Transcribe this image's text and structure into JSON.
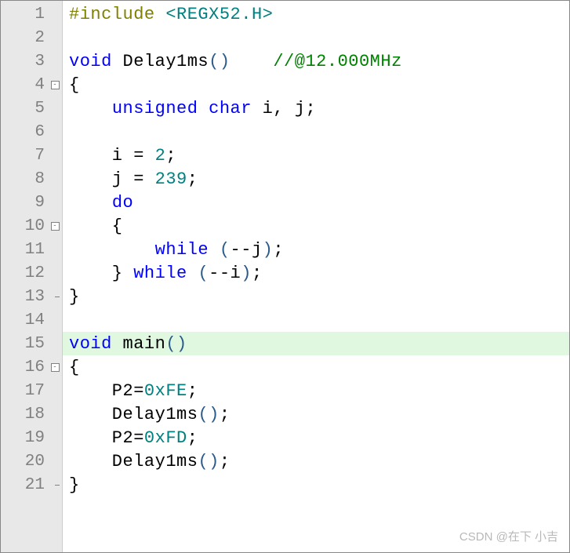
{
  "lines": [
    {
      "n": "1",
      "fold": "none",
      "hl": false,
      "tokens": [
        {
          "c": "preproc",
          "t": "#include "
        },
        {
          "c": "include",
          "t": "<REGX52.H>"
        }
      ]
    },
    {
      "n": "2",
      "fold": "none",
      "hl": false,
      "tokens": []
    },
    {
      "n": "3",
      "fold": "none",
      "hl": false,
      "tokens": [
        {
          "c": "keyword",
          "t": "void"
        },
        {
          "c": "text",
          "t": " Delay1ms"
        },
        {
          "c": "paren",
          "t": "()"
        },
        {
          "c": "text",
          "t": "    "
        },
        {
          "c": "comment",
          "t": "//@12.000MHz"
        }
      ]
    },
    {
      "n": "4",
      "fold": "open-start",
      "hl": false,
      "tokens": [
        {
          "c": "text",
          "t": "{"
        }
      ]
    },
    {
      "n": "5",
      "fold": "line",
      "hl": false,
      "tokens": [
        {
          "c": "text",
          "t": "    "
        },
        {
          "c": "keyword",
          "t": "unsigned"
        },
        {
          "c": "text",
          "t": " "
        },
        {
          "c": "keyword",
          "t": "char"
        },
        {
          "c": "text",
          "t": " i, j;"
        }
      ]
    },
    {
      "n": "6",
      "fold": "line",
      "hl": false,
      "tokens": []
    },
    {
      "n": "7",
      "fold": "line",
      "hl": false,
      "tokens": [
        {
          "c": "text",
          "t": "    i = "
        },
        {
          "c": "number",
          "t": "2"
        },
        {
          "c": "text",
          "t": ";"
        }
      ]
    },
    {
      "n": "8",
      "fold": "line",
      "hl": false,
      "tokens": [
        {
          "c": "text",
          "t": "    j = "
        },
        {
          "c": "number",
          "t": "239"
        },
        {
          "c": "text",
          "t": ";"
        }
      ]
    },
    {
      "n": "9",
      "fold": "line",
      "hl": false,
      "tokens": [
        {
          "c": "text",
          "t": "    "
        },
        {
          "c": "keyword",
          "t": "do"
        }
      ]
    },
    {
      "n": "10",
      "fold": "open-mid",
      "hl": false,
      "tokens": [
        {
          "c": "text",
          "t": "    {"
        }
      ]
    },
    {
      "n": "11",
      "fold": "line",
      "hl": false,
      "tokens": [
        {
          "c": "text",
          "t": "        "
        },
        {
          "c": "keyword",
          "t": "while"
        },
        {
          "c": "text",
          "t": " "
        },
        {
          "c": "paren",
          "t": "("
        },
        {
          "c": "text",
          "t": "--j"
        },
        {
          "c": "paren",
          "t": ")"
        },
        {
          "c": "text",
          "t": ";"
        }
      ]
    },
    {
      "n": "12",
      "fold": "line",
      "hl": false,
      "tokens": [
        {
          "c": "text",
          "t": "    } "
        },
        {
          "c": "keyword",
          "t": "while"
        },
        {
          "c": "text",
          "t": " "
        },
        {
          "c": "paren",
          "t": "("
        },
        {
          "c": "text",
          "t": "--i"
        },
        {
          "c": "paren",
          "t": ")"
        },
        {
          "c": "text",
          "t": ";"
        }
      ]
    },
    {
      "n": "13",
      "fold": "end",
      "hl": false,
      "tokens": [
        {
          "c": "text",
          "t": "}"
        }
      ]
    },
    {
      "n": "14",
      "fold": "none",
      "hl": false,
      "tokens": []
    },
    {
      "n": "15",
      "fold": "none",
      "hl": true,
      "tokens": [
        {
          "c": "keyword",
          "t": "void"
        },
        {
          "c": "text",
          "t": " main"
        },
        {
          "c": "paren",
          "t": "()"
        }
      ]
    },
    {
      "n": "16",
      "fold": "open-start",
      "hl": false,
      "tokens": [
        {
          "c": "text",
          "t": "{"
        }
      ]
    },
    {
      "n": "17",
      "fold": "line",
      "hl": false,
      "tokens": [
        {
          "c": "text",
          "t": "    P2="
        },
        {
          "c": "number",
          "t": "0xFE"
        },
        {
          "c": "text",
          "t": ";"
        }
      ]
    },
    {
      "n": "18",
      "fold": "line",
      "hl": false,
      "tokens": [
        {
          "c": "text",
          "t": "    Delay1ms"
        },
        {
          "c": "paren",
          "t": "()"
        },
        {
          "c": "text",
          "t": ";"
        }
      ]
    },
    {
      "n": "19",
      "fold": "line",
      "hl": false,
      "tokens": [
        {
          "c": "text",
          "t": "    P2="
        },
        {
          "c": "number",
          "t": "0xFD"
        },
        {
          "c": "text",
          "t": ";"
        }
      ]
    },
    {
      "n": "20",
      "fold": "line",
      "hl": false,
      "tokens": [
        {
          "c": "text",
          "t": "    Delay1ms"
        },
        {
          "c": "paren",
          "t": "()"
        },
        {
          "c": "text",
          "t": ";"
        }
      ]
    },
    {
      "n": "21",
      "fold": "end",
      "hl": false,
      "tokens": [
        {
          "c": "text",
          "t": "}"
        }
      ]
    }
  ],
  "fold_minus": "-",
  "watermark": "CSDN @在下 小吉"
}
